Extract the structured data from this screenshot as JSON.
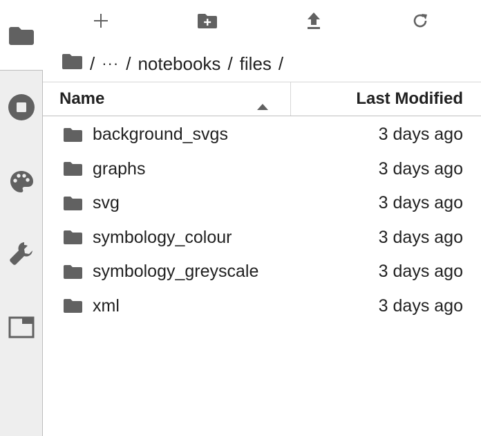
{
  "activity_bar": {
    "tabs": [
      {
        "icon": "folder-icon",
        "active": true
      },
      {
        "icon": "stop-circle-icon",
        "active": false
      },
      {
        "icon": "palette-icon",
        "active": false
      },
      {
        "icon": "wrench-icon",
        "active": false
      },
      {
        "icon": "tab-window-icon",
        "active": false
      }
    ]
  },
  "toolbar": {
    "buttons": [
      "new-launcher-icon",
      "new-folder-icon",
      "upload-icon",
      "refresh-icon"
    ]
  },
  "breadcrumbs": {
    "separator": "/",
    "ellipsis": "···",
    "parts": [
      "notebooks",
      "files"
    ]
  },
  "list_header": {
    "name_label": "Name",
    "modified_label": "Last Modified",
    "sort": "ascending"
  },
  "files": [
    {
      "name": "background_svgs",
      "modified": "3 days ago",
      "type": "folder"
    },
    {
      "name": "graphs",
      "modified": "3 days ago",
      "type": "folder"
    },
    {
      "name": "svg",
      "modified": "3 days ago",
      "type": "folder"
    },
    {
      "name": "symbology_colour",
      "modified": "3 days ago",
      "type": "folder"
    },
    {
      "name": "symbology_greyscale",
      "modified": "3 days ago",
      "type": "folder"
    },
    {
      "name": "xml",
      "modified": "3 days ago",
      "type": "folder"
    }
  ],
  "colors": {
    "icon": "#616161",
    "text": "#212121",
    "sidebar_bg": "#eeeeee"
  }
}
